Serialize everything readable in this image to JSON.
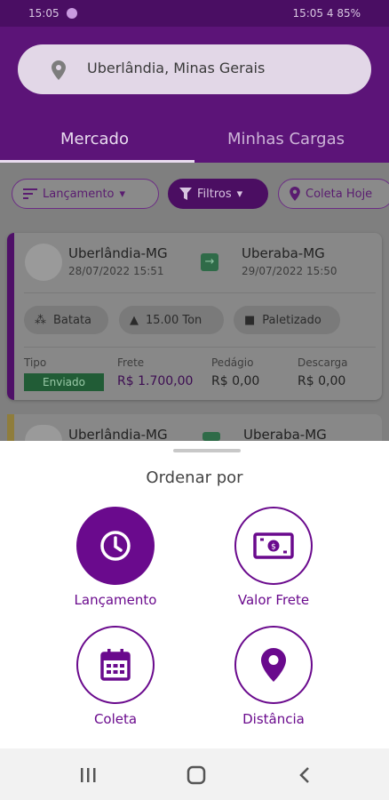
{
  "status_bar": {
    "left_text": "15:05",
    "right_text": "15:05 4 85%"
  },
  "search": {
    "value": "Uberlândia, Minas Gerais"
  },
  "tabs": [
    {
      "label": "Mercado",
      "active": true
    },
    {
      "label": "Minhas Cargas",
      "active": false
    }
  ],
  "filters": {
    "sort_label": "Lançamento",
    "filters_label": "Filtros",
    "pickup_label": "Coleta Hoje"
  },
  "card": {
    "origin_city": "Uberlândia-MG",
    "origin_date": "28/07/2022 15:51",
    "dest_city": "Uberaba-MG",
    "dest_date": "29/07/2022 15:50",
    "tags": [
      "Batata",
      "15.00 Ton",
      "Paletizado"
    ],
    "labels": {
      "tipo": "Tipo",
      "frete": "Frete",
      "pedagio": "Pedágio",
      "descarga": "Descarga"
    },
    "tipo_value": "Enviado",
    "frete_value": "R$ 1.700,00",
    "pedagio_value": "R$ 0,00",
    "descarga_value": "R$ 0,00"
  },
  "card2": {
    "origin_city": "Uberlândia-MG",
    "dest_city": "Uberaba-MG"
  },
  "sheet": {
    "title": "Ordenar por",
    "options": [
      {
        "label": "Lançamento",
        "icon": "clock-icon",
        "selected": true
      },
      {
        "label": "Valor Frete",
        "icon": "banknote-icon",
        "selected": false
      },
      {
        "label": "Coleta",
        "icon": "calendar-icon",
        "selected": false
      },
      {
        "label": "Distância",
        "icon": "map-pin-icon",
        "selected": false
      }
    ]
  },
  "colors": {
    "primary": "#6a0a8d",
    "header": "#5c1478",
    "scrim": "#7f7f7f"
  }
}
